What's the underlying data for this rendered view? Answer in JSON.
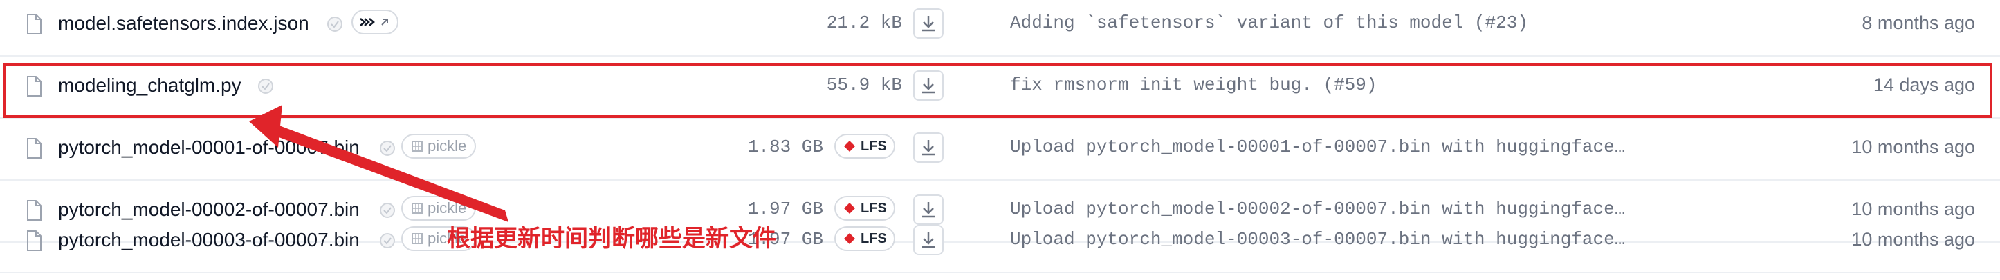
{
  "files": [
    {
      "name": "model.safetensors.index.json",
      "tag": "safetensors-link",
      "size": "21.2 kB",
      "commit": "Adding `safetensors` variant of this model (#23)",
      "date": "8 months ago"
    },
    {
      "name": "modeling_chatglm.py",
      "tag": "",
      "size": "55.9 kB",
      "commit": "fix rmsnorm init weight bug. (#59)",
      "date": "14 days ago"
    },
    {
      "name": "pytorch_model-00001-of-00007.bin",
      "tag": "pickle",
      "lfs": "LFS",
      "size": "1.83 GB",
      "commit": "Upload pytorch_model-00001-of-00007.bin with huggingface…",
      "date": "10 months ago"
    },
    {
      "name": "pytorch_model-00002-of-00007.bin",
      "tag": "pickle",
      "lfs": "LFS",
      "size": "1.97 GB",
      "commit": "Upload pytorch_model-00002-of-00007.bin with huggingface…",
      "date": "10 months ago"
    },
    {
      "name": "pytorch_model-00003-of-00007.bin",
      "tag": "pickle",
      "lfs": "LFS",
      "size": "1.97 GB",
      "commit": "Upload pytorch_model-00003-of-00007.bin with huggingface…",
      "date": "10 months ago"
    }
  ],
  "annotation": {
    "text": "根据更新时间判断哪些是新文件",
    "color": "#e0242a"
  },
  "colors": {
    "lfs_icon": "#e0242a",
    "text_muted": "#6b7280",
    "border": "#eceff3"
  },
  "icons": {
    "file": "file-icon",
    "verified": "verified-check-icon",
    "download": "download-icon",
    "lfs": "lfs-diamond-icon",
    "pickle": "pickle-grid-icon",
    "safetensors_link": "safetensors-link-icon"
  }
}
